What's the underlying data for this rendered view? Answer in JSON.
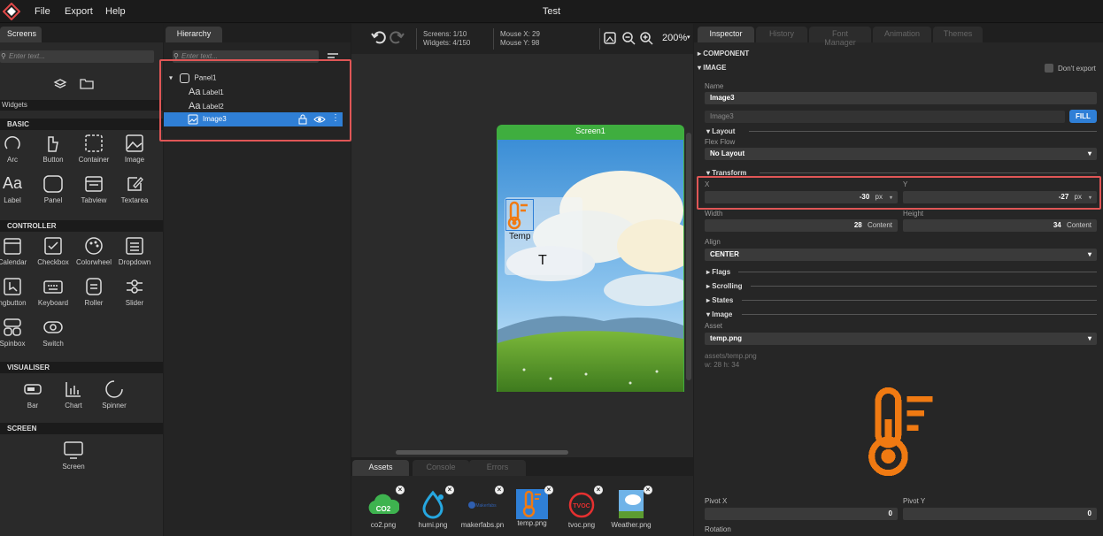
{
  "menubar": {
    "title": "Test",
    "items": [
      "File",
      "Export",
      "Help"
    ]
  },
  "left": {
    "tab": "Screens",
    "search_placeholder": "Enter text...",
    "widgets_label": "Widgets",
    "sections": {
      "basic": "BASIC",
      "controller": "CONTROLLER",
      "visualiser": "VISUALISER",
      "screen": "SCREEN"
    },
    "basic": [
      "Arc",
      "Button",
      "Container",
      "Image",
      "Label",
      "Panel",
      "Tabview",
      "Textarea"
    ],
    "controller": [
      "Calendar",
      "Checkbox",
      "Colorwheel",
      "Dropdown",
      "ngbutton",
      "Keyboard",
      "Roller",
      "Slider",
      "Spinbox",
      "Switch"
    ],
    "visualiser": [
      "Bar",
      "Chart",
      "Spinner"
    ],
    "screen": [
      "Screen"
    ]
  },
  "hierarchy": {
    "tab": "Hierarchy",
    "search_placeholder": "Enter text...",
    "items": [
      "Panel1",
      "Label1",
      "Label2",
      "Image3"
    ]
  },
  "toolbar": {
    "screens": "Screens: 1/10",
    "widgets": "Widgets: 4/150",
    "mouse_x": "Mouse X: 29",
    "mouse_y": "Mouse Y: 98",
    "zoom": "200%"
  },
  "canvas": {
    "screen_title": "Screen1",
    "temp_label": "Temp",
    "t_label": "T"
  },
  "bottom_tabs": [
    "Assets",
    "Console",
    "Errors"
  ],
  "assets": [
    "co2.png",
    "humi.png",
    "makerfabs.pn",
    "temp.png",
    "tvoc.png",
    "Weather.png"
  ],
  "assets_thumb_text": {
    "co2": "CO2",
    "makerfabs": "Makerfabs",
    "tvoc": "TVOC"
  },
  "inspector": {
    "tabs": [
      "Inspector",
      "History",
      "Font Manager",
      "Animation",
      "Themes"
    ],
    "component": "COMPONENT",
    "image_section": "IMAGE",
    "dont_export": "Don't export",
    "name_label": "Name",
    "name_value": "Image3",
    "id_value": "Image3",
    "fill_btn": "FILL",
    "layout": "Layout",
    "flex_flow_label": "Flex Flow",
    "flex_flow_value": "No Layout",
    "transform": "Transform",
    "x_label": "X",
    "x_value": "-30",
    "x_unit": "px",
    "y_label": "Y",
    "y_value": "-27",
    "y_unit": "px",
    "width_label": "Width",
    "width_value": "28",
    "width_unit": "Content",
    "height_label": "Height",
    "height_value": "34",
    "height_unit": "Content",
    "align_label": "Align",
    "align_value": "CENTER",
    "collapsed": [
      "Flags",
      "Scrolling",
      "States"
    ],
    "image_sub": "Image",
    "asset_label": "Asset",
    "asset_value": "temp.png",
    "asset_path": "assets/temp.png",
    "asset_dims": "w: 28  h: 34",
    "pivot_x_label": "Pivot X",
    "pivot_x_value": "0",
    "pivot_y_label": "Pivot Y",
    "pivot_y_value": "0",
    "rotation_label": "Rotation"
  },
  "colors": {
    "accent": "#2f7fd6",
    "green": "#3fae3f",
    "red": "#e05656",
    "orange": "#f07a12"
  }
}
